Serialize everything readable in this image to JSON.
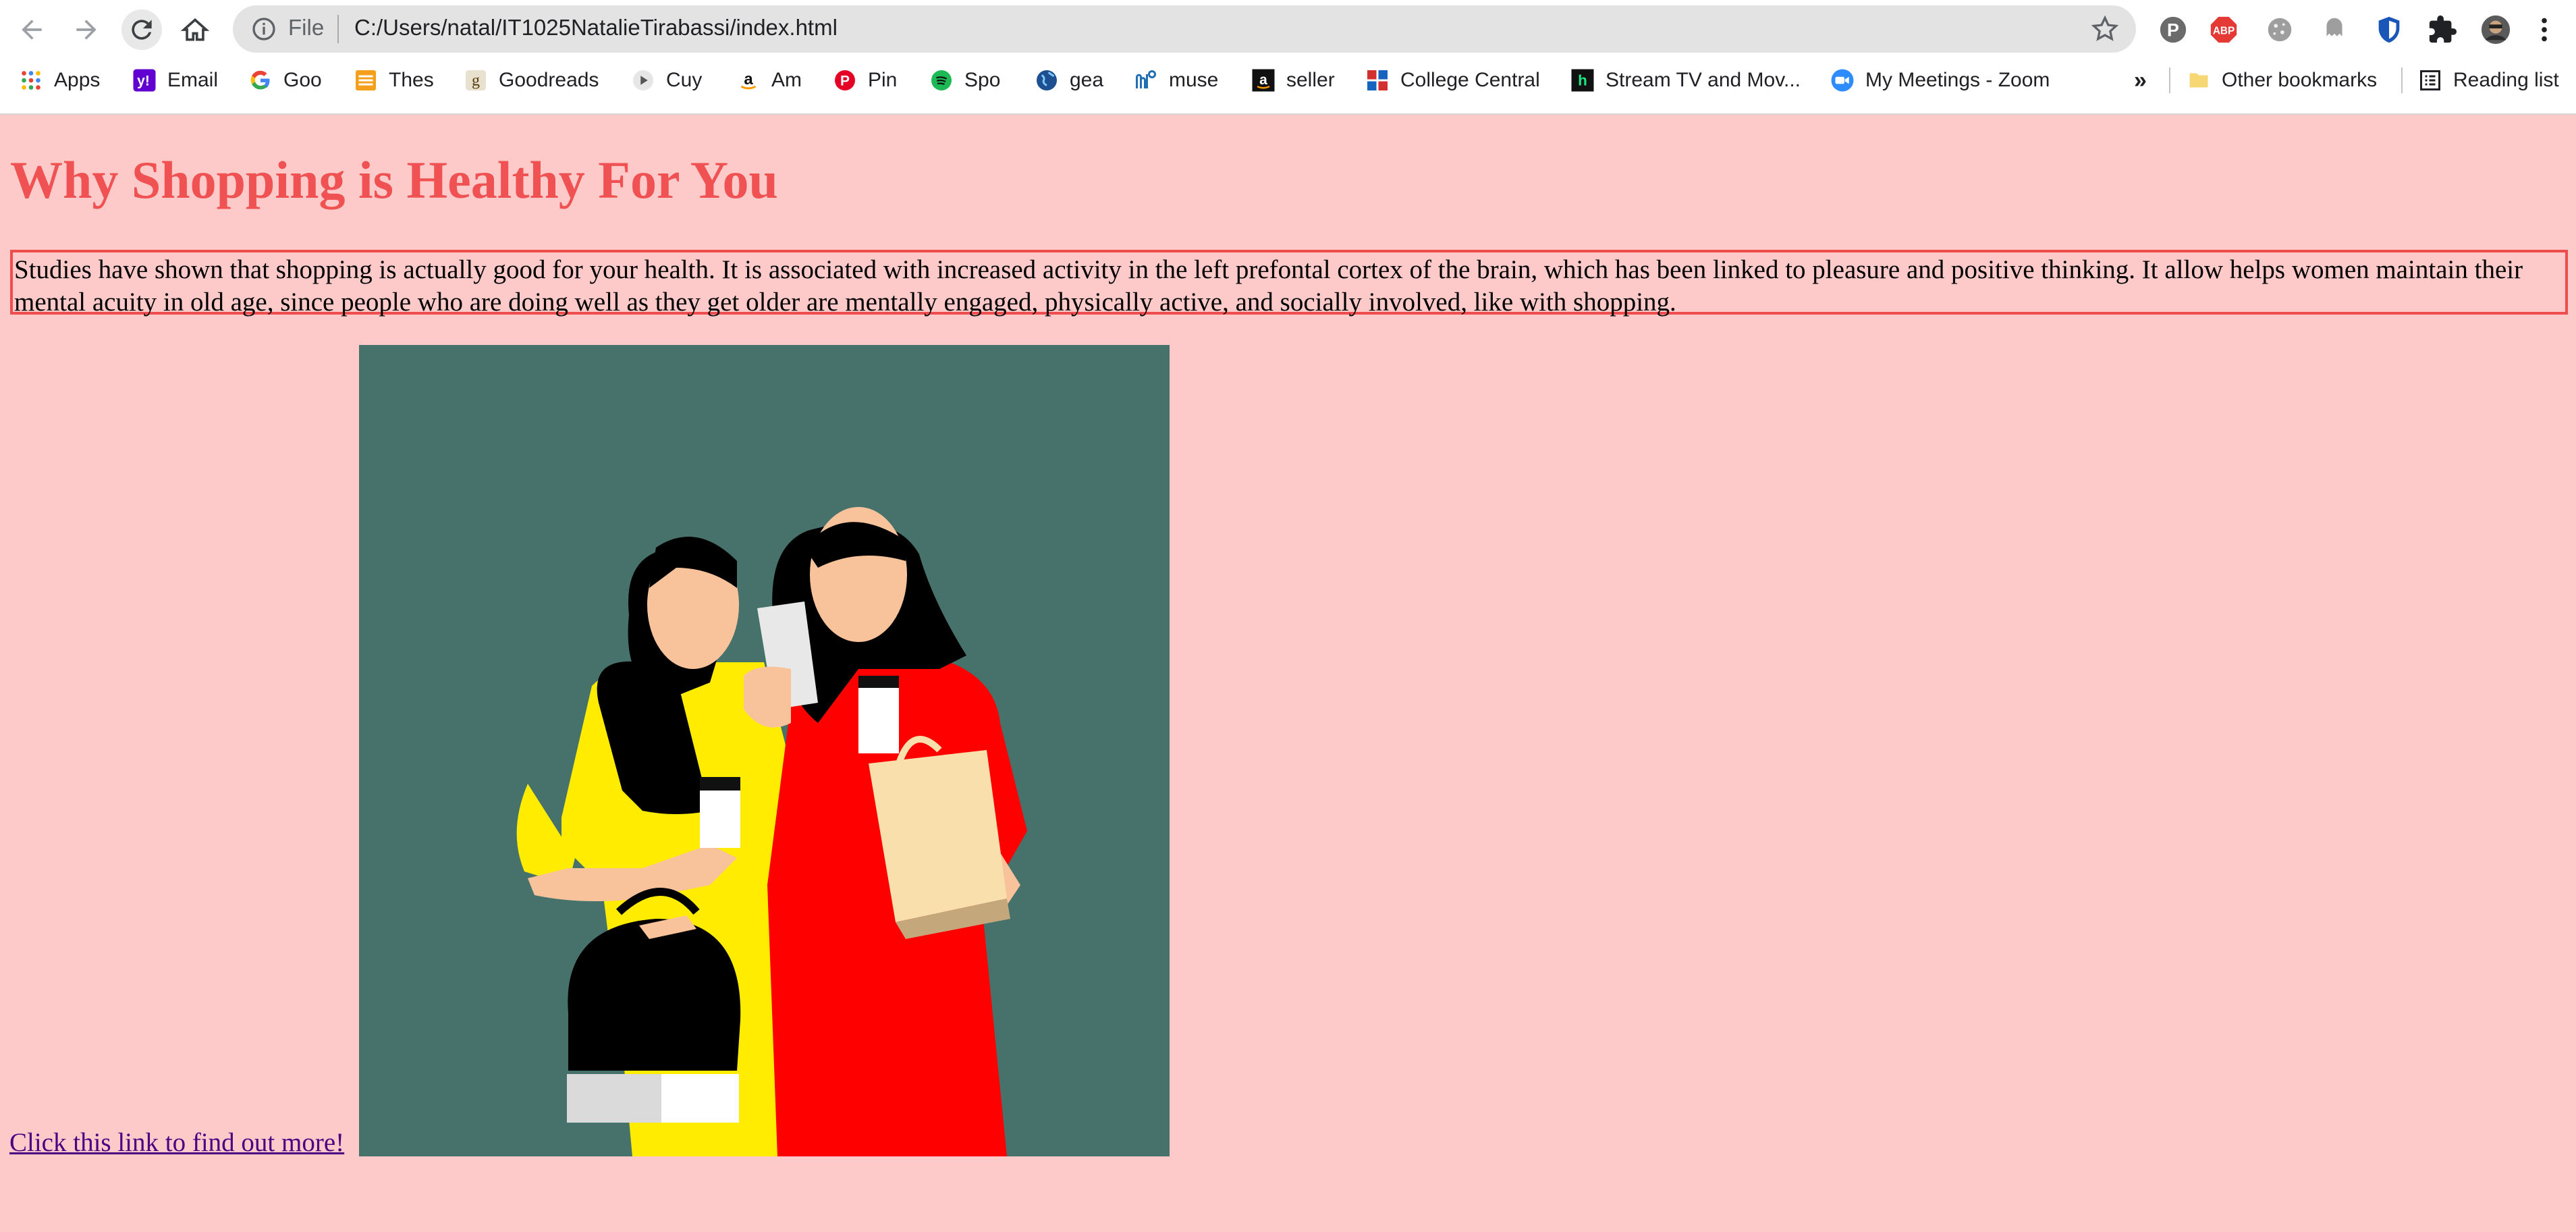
{
  "browser": {
    "address": {
      "scheme_label": "File",
      "url": "C:/Users/natal/IT1025NatalieTirabassi/index.html"
    },
    "bookmarks": [
      {
        "label": "Apps",
        "icon": "apps-grid-icon"
      },
      {
        "label": "Email",
        "icon": "yahoo-icon"
      },
      {
        "label": "Goo",
        "icon": "google-icon"
      },
      {
        "label": "Thes",
        "icon": "thesaurus-icon"
      },
      {
        "label": "Goodreads",
        "icon": "goodreads-icon"
      },
      {
        "label": "Cuy",
        "icon": "play-icon"
      },
      {
        "label": "Am",
        "icon": "amazon-icon"
      },
      {
        "label": "Pin",
        "icon": "pinterest-icon"
      },
      {
        "label": "Spo",
        "icon": "spotify-icon"
      },
      {
        "label": "gea",
        "icon": "globe-icon"
      },
      {
        "label": "muse",
        "icon": "muse-icon"
      },
      {
        "label": "seller",
        "icon": "amazon-seller-icon"
      },
      {
        "label": "College Central",
        "icon": "college-central-icon"
      },
      {
        "label": "Stream TV and Mov...",
        "icon": "hulu-icon"
      },
      {
        "label": "My Meetings - Zoom",
        "icon": "zoom-icon"
      }
    ],
    "overflow_label": "»",
    "other_bookmarks": "Other bookmarks",
    "reading_list": "Reading list",
    "extension_icons": [
      "pinterest-icon",
      "adblock-plus-icon",
      "cookie-icon",
      "ghostery-icon",
      "shield-icon",
      "puzzle-extensions-icon",
      "profile-avatar-icon",
      "kebab-menu-icon"
    ]
  },
  "page": {
    "title": "Why Shopping is Healthy For You",
    "intro": "Studies have shown that shopping is actually good for your health. It is associated with increased activity in the left prefontal cortex of the brain, which has been linked to pleasure and positive thinking. It allow helps women maintain their mental acuity in old age, since people who are doing well as they get older are mentally engaged, physically active, and socially involved, like with shopping.",
    "link_text": "Click this link to find out more!"
  },
  "colors": {
    "page_background": "#fdc9c9",
    "title": "#f05152",
    "border": "#ef4d4d",
    "link": "#4b0082",
    "illustration_background": "#47726b"
  }
}
